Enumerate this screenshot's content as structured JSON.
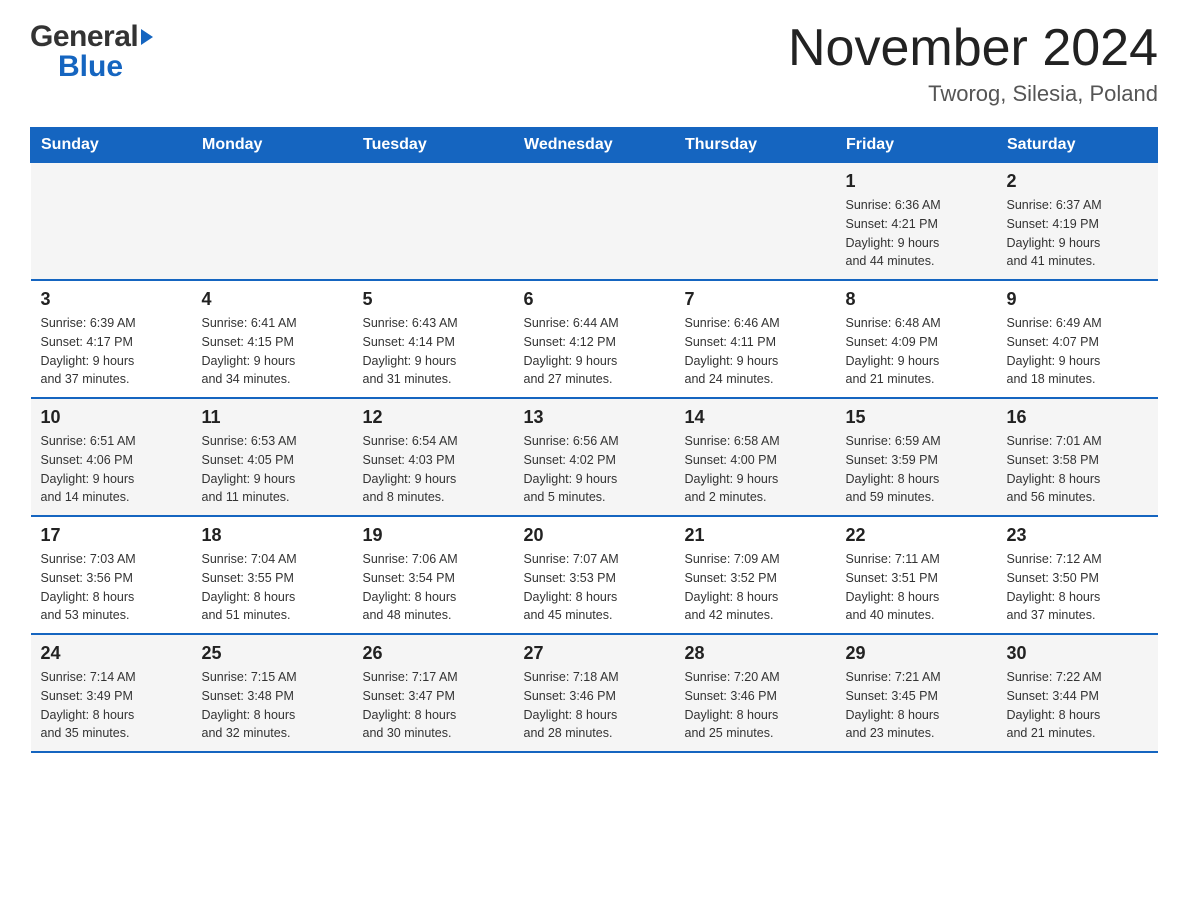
{
  "header": {
    "logo": {
      "general": "General",
      "triangle_char": "▶",
      "blue": "Blue"
    },
    "title": "November 2024",
    "subtitle": "Tworog, Silesia, Poland"
  },
  "weekdays": [
    "Sunday",
    "Monday",
    "Tuesday",
    "Wednesday",
    "Thursday",
    "Friday",
    "Saturday"
  ],
  "rows": [
    {
      "cells": [
        {
          "day": "",
          "info": ""
        },
        {
          "day": "",
          "info": ""
        },
        {
          "day": "",
          "info": ""
        },
        {
          "day": "",
          "info": ""
        },
        {
          "day": "",
          "info": ""
        },
        {
          "day": "1",
          "info": "Sunrise: 6:36 AM\nSunset: 4:21 PM\nDaylight: 9 hours\nand 44 minutes."
        },
        {
          "day": "2",
          "info": "Sunrise: 6:37 AM\nSunset: 4:19 PM\nDaylight: 9 hours\nand 41 minutes."
        }
      ]
    },
    {
      "cells": [
        {
          "day": "3",
          "info": "Sunrise: 6:39 AM\nSunset: 4:17 PM\nDaylight: 9 hours\nand 37 minutes."
        },
        {
          "day": "4",
          "info": "Sunrise: 6:41 AM\nSunset: 4:15 PM\nDaylight: 9 hours\nand 34 minutes."
        },
        {
          "day": "5",
          "info": "Sunrise: 6:43 AM\nSunset: 4:14 PM\nDaylight: 9 hours\nand 31 minutes."
        },
        {
          "day": "6",
          "info": "Sunrise: 6:44 AM\nSunset: 4:12 PM\nDaylight: 9 hours\nand 27 minutes."
        },
        {
          "day": "7",
          "info": "Sunrise: 6:46 AM\nSunset: 4:11 PM\nDaylight: 9 hours\nand 24 minutes."
        },
        {
          "day": "8",
          "info": "Sunrise: 6:48 AM\nSunset: 4:09 PM\nDaylight: 9 hours\nand 21 minutes."
        },
        {
          "day": "9",
          "info": "Sunrise: 6:49 AM\nSunset: 4:07 PM\nDaylight: 9 hours\nand 18 minutes."
        }
      ]
    },
    {
      "cells": [
        {
          "day": "10",
          "info": "Sunrise: 6:51 AM\nSunset: 4:06 PM\nDaylight: 9 hours\nand 14 minutes."
        },
        {
          "day": "11",
          "info": "Sunrise: 6:53 AM\nSunset: 4:05 PM\nDaylight: 9 hours\nand 11 minutes."
        },
        {
          "day": "12",
          "info": "Sunrise: 6:54 AM\nSunset: 4:03 PM\nDaylight: 9 hours\nand 8 minutes."
        },
        {
          "day": "13",
          "info": "Sunrise: 6:56 AM\nSunset: 4:02 PM\nDaylight: 9 hours\nand 5 minutes."
        },
        {
          "day": "14",
          "info": "Sunrise: 6:58 AM\nSunset: 4:00 PM\nDaylight: 9 hours\nand 2 minutes."
        },
        {
          "day": "15",
          "info": "Sunrise: 6:59 AM\nSunset: 3:59 PM\nDaylight: 8 hours\nand 59 minutes."
        },
        {
          "day": "16",
          "info": "Sunrise: 7:01 AM\nSunset: 3:58 PM\nDaylight: 8 hours\nand 56 minutes."
        }
      ]
    },
    {
      "cells": [
        {
          "day": "17",
          "info": "Sunrise: 7:03 AM\nSunset: 3:56 PM\nDaylight: 8 hours\nand 53 minutes."
        },
        {
          "day": "18",
          "info": "Sunrise: 7:04 AM\nSunset: 3:55 PM\nDaylight: 8 hours\nand 51 minutes."
        },
        {
          "day": "19",
          "info": "Sunrise: 7:06 AM\nSunset: 3:54 PM\nDaylight: 8 hours\nand 48 minutes."
        },
        {
          "day": "20",
          "info": "Sunrise: 7:07 AM\nSunset: 3:53 PM\nDaylight: 8 hours\nand 45 minutes."
        },
        {
          "day": "21",
          "info": "Sunrise: 7:09 AM\nSunset: 3:52 PM\nDaylight: 8 hours\nand 42 minutes."
        },
        {
          "day": "22",
          "info": "Sunrise: 7:11 AM\nSunset: 3:51 PM\nDaylight: 8 hours\nand 40 minutes."
        },
        {
          "day": "23",
          "info": "Sunrise: 7:12 AM\nSunset: 3:50 PM\nDaylight: 8 hours\nand 37 minutes."
        }
      ]
    },
    {
      "cells": [
        {
          "day": "24",
          "info": "Sunrise: 7:14 AM\nSunset: 3:49 PM\nDaylight: 8 hours\nand 35 minutes."
        },
        {
          "day": "25",
          "info": "Sunrise: 7:15 AM\nSunset: 3:48 PM\nDaylight: 8 hours\nand 32 minutes."
        },
        {
          "day": "26",
          "info": "Sunrise: 7:17 AM\nSunset: 3:47 PM\nDaylight: 8 hours\nand 30 minutes."
        },
        {
          "day": "27",
          "info": "Sunrise: 7:18 AM\nSunset: 3:46 PM\nDaylight: 8 hours\nand 28 minutes."
        },
        {
          "day": "28",
          "info": "Sunrise: 7:20 AM\nSunset: 3:46 PM\nDaylight: 8 hours\nand 25 minutes."
        },
        {
          "day": "29",
          "info": "Sunrise: 7:21 AM\nSunset: 3:45 PM\nDaylight: 8 hours\nand 23 minutes."
        },
        {
          "day": "30",
          "info": "Sunrise: 7:22 AM\nSunset: 3:44 PM\nDaylight: 8 hours\nand 21 minutes."
        }
      ]
    }
  ]
}
